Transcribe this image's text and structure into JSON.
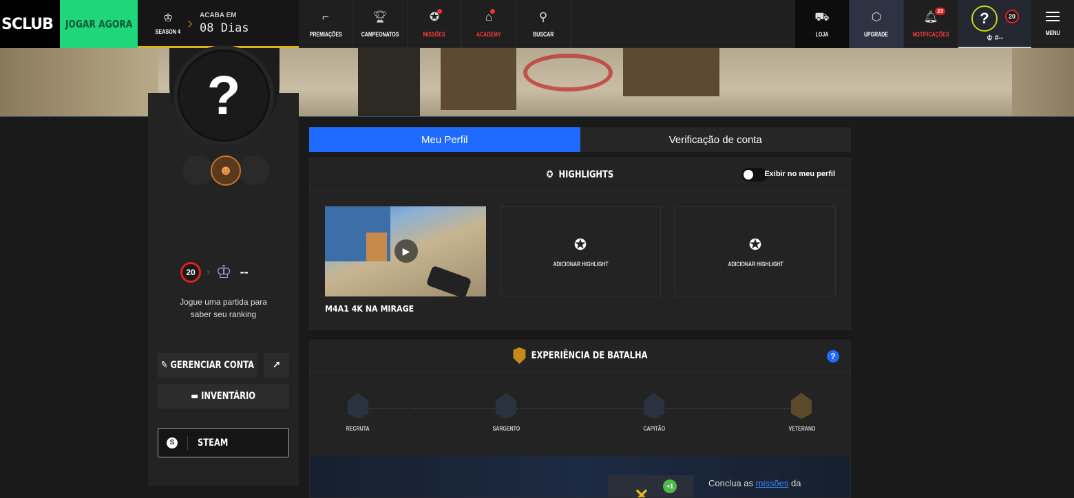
{
  "brand": {
    "logo_text": "SCLUB"
  },
  "topbar": {
    "play_label": "JOGAR AGORA",
    "season_label": "SEASON 4",
    "ends_label": "ACABA EM",
    "ends_value": "08 Dias",
    "nav": [
      {
        "label": "PREMIAÇÕES",
        "icon": "gun-icon"
      },
      {
        "label": "CAMPEONATOS",
        "icon": "trophy-icon"
      },
      {
        "label": "MISSÕES",
        "icon": "medal-icon"
      },
      {
        "label": "ACADEMY",
        "icon": "graduation-cap-icon"
      },
      {
        "label": "BUSCAR",
        "icon": "search-icon"
      }
    ],
    "shop_label": "LOJA",
    "upgrade_label": "UPGRADE",
    "notifications_label": "NOTIFICAÇÕES",
    "notifications_count": "33",
    "profile_level": "20",
    "profile_rank": "#--",
    "menu_label": "MENU"
  },
  "sidebar": {
    "avatar_glyph": "?",
    "level": "20",
    "rank_value": "--",
    "rank_text_line1": "Jogue uma partida para",
    "rank_text_line2": "saber seu ranking",
    "manage_label": "GERENCIAR CONTA",
    "inventory_label": "INVENTÁRIO",
    "steam_label": "STEAM"
  },
  "tabs": [
    {
      "label": "Meu Perfil",
      "active": true
    },
    {
      "label": "Verificação de conta",
      "active": false
    }
  ],
  "highlights": {
    "title": "HIGHLIGHTS",
    "toggle_label": "Exibir no meu perfil",
    "video_title": "M4A1 4K NA MIRAGE",
    "add_label": "ADICIONAR HIGHLIGHT"
  },
  "battle_xp": {
    "title": "EXPERIÊNCIA DE BATALHA",
    "ranks": [
      "RECRUTA",
      "SARGENTO",
      "CAPITÃO",
      "VETERANO"
    ],
    "plus_badge": "+1",
    "text_prefix": "Conclua as",
    "text_link": "missões",
    "text_suffix": "da"
  },
  "colors": {
    "accent": "#1f6bff",
    "play": "#1fd67a",
    "season_bar": "#d9b21c",
    "danger": "#e02020"
  }
}
